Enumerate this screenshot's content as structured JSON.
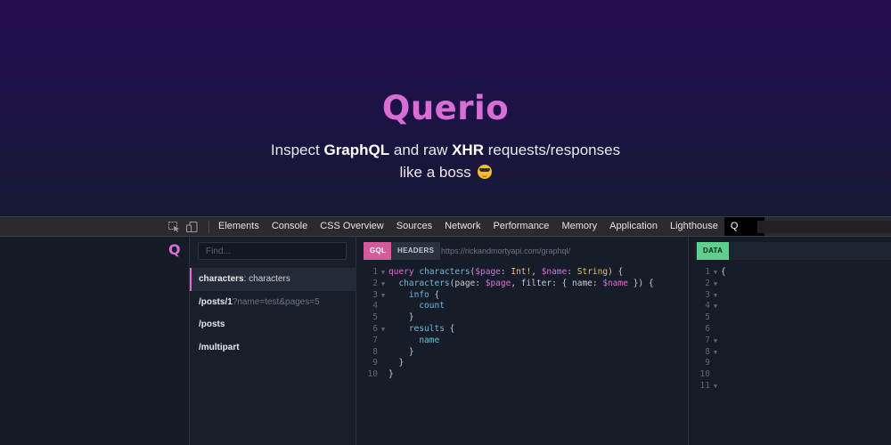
{
  "hero": {
    "title": "Querio",
    "line1_pre": "Inspect ",
    "line1_b1": "GraphQL",
    "line1_mid": " and raw ",
    "line1_b2": "XHR",
    "line1_post": " requests/responses",
    "line2": "like a boss"
  },
  "devtools": {
    "tabs": [
      "Elements",
      "Console",
      "CSS Overview",
      "Sources",
      "Network",
      "Performance",
      "Memory",
      "Application",
      "Lighthouse",
      "Q"
    ],
    "active_tab": "Q"
  },
  "panel": {
    "logo": "Q",
    "search_placeholder": "Find...",
    "requests": [
      {
        "bold": "characters",
        "rest": ": characters",
        "query": ""
      },
      {
        "bold": "/posts/1",
        "rest": "",
        "query": "?name=test&pages=5"
      },
      {
        "bold": "/posts",
        "rest": "",
        "query": ""
      },
      {
        "bold": "/multipart",
        "rest": "",
        "query": ""
      }
    ],
    "editor": {
      "gql_tab": "GQL",
      "headers_tab": "HEADERS",
      "url": "https://rickandmortyapi.com/graphql/"
    },
    "result": {
      "data_tab": "DATA",
      "line_numbers": [
        "1",
        "2",
        "3",
        "4",
        "5",
        "6",
        "7",
        "8",
        "9",
        "10",
        "11"
      ],
      "first_line": "{"
    }
  },
  "colors": {
    "accent": "#d86ed5",
    "gql_tab": "#d75a9c",
    "data_tab": "#5fcf8e"
  }
}
